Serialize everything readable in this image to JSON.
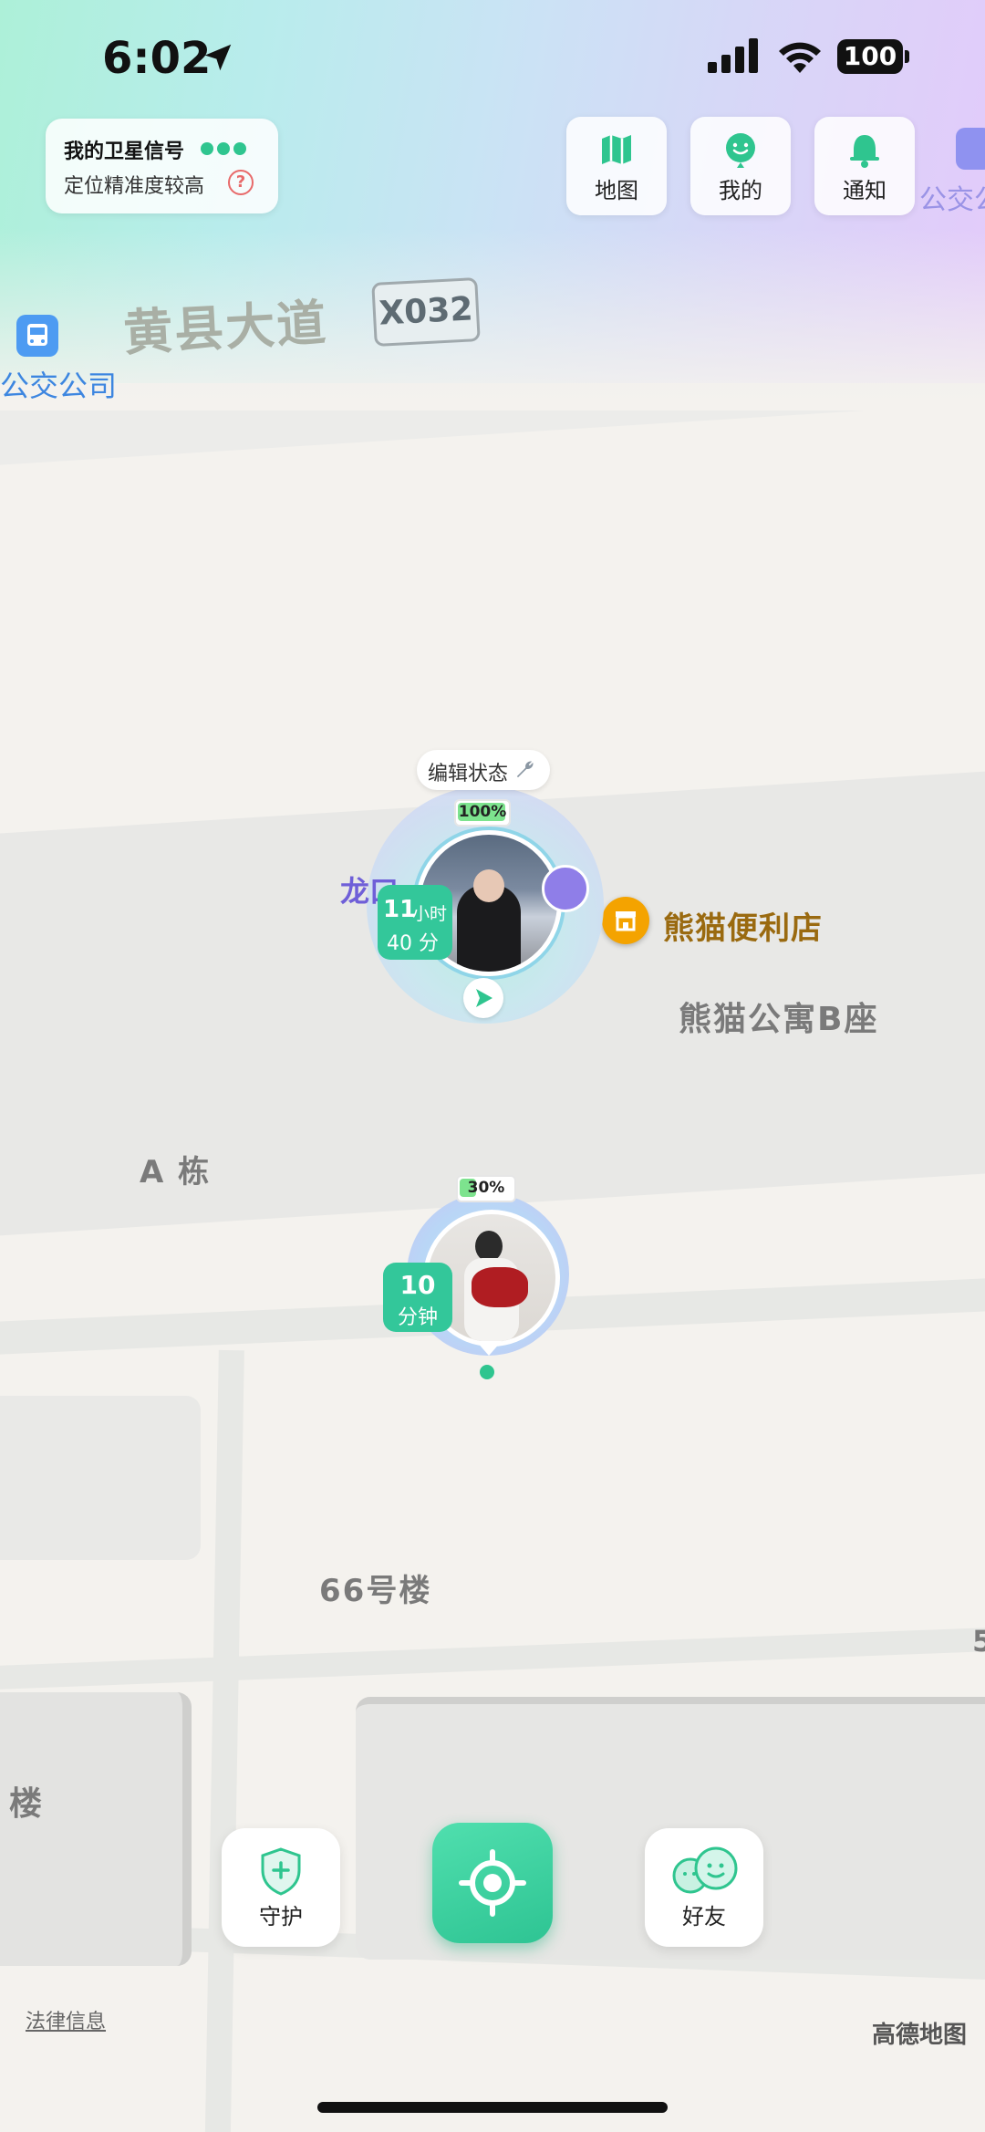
{
  "status_bar": {
    "time": "6:02",
    "battery": "100"
  },
  "satellite_panel": {
    "title": "我的卫星信号",
    "subtitle": "定位精准度较高",
    "help_icon": "?"
  },
  "top_buttons": [
    {
      "label": "地图",
      "icon": "map-icon"
    },
    {
      "label": "我的",
      "icon": "smile-face-icon"
    },
    {
      "label": "通知",
      "icon": "bell-icon"
    }
  ],
  "partial_top_label": "公交公",
  "map": {
    "road_name": "黄县大道",
    "road_code": "X032",
    "bus_label": "公交公司",
    "poi_longkou": "龙口",
    "shop_name": "熊猫便利店",
    "building_b": "熊猫公寓B座",
    "building_a": "A 栋",
    "building_66": "66号楼",
    "partial_building": "楼",
    "partial_number": "5"
  },
  "user_marker_1": {
    "edit_status": "编辑状态",
    "battery": "100%",
    "time_num": "11",
    "time_unit_hour": "小时",
    "time_min": "40 分"
  },
  "user_marker_2": {
    "battery": "30%",
    "time_num": "10",
    "time_unit": "分钟"
  },
  "bottom_buttons": {
    "guard": "守护",
    "friends": "好友"
  },
  "footer": {
    "legal": "法律信息",
    "map_provider": "高德地图"
  },
  "colors": {
    "accent_green": "#2fc58f",
    "shop_orange": "#f4a300",
    "purple": "#8b79e8"
  }
}
